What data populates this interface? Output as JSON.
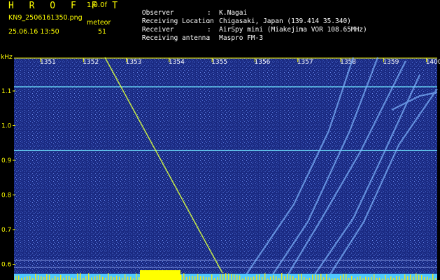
{
  "header": {
    "brand": "H R O F F T",
    "version": "1.0.0f",
    "filename": "KN9_2506161350.png",
    "meteor_label": "meteor",
    "datetime": "25.06.16 13:50",
    "meteor_count": "51",
    "info": [
      {
        "label": "Observer",
        "value": ":  K.Nagai"
      },
      {
        "label": "Receiving Location",
        "value": ":  Chigasaki, Japan (139.414 35.340)"
      },
      {
        "label": "Receiver",
        "value": ":  AirSpy mini (Miakejima VOR 108.65MHz)"
      },
      {
        "label": "Receiving antenna",
        "value": ":  Maspro FM-3"
      }
    ]
  },
  "plot": {
    "y_unit": "kHz",
    "x_ticks": [
      "1351",
      "1352",
      "1353",
      "1354",
      "1355",
      "1356",
      "1357",
      "1358",
      "1359",
      "1400"
    ],
    "y_ticks": [
      "1.1",
      "1.0",
      "0.9",
      "0.8",
      "0.7",
      "0.6"
    ],
    "colors": {
      "background": "#1a2a82",
      "noise": "#5f86e6",
      "carrier": "#6fe6ff",
      "meteor_trace": "#d8ff40",
      "ticks": "#ffff00",
      "bottom_band": "#50c8ff"
    }
  }
}
